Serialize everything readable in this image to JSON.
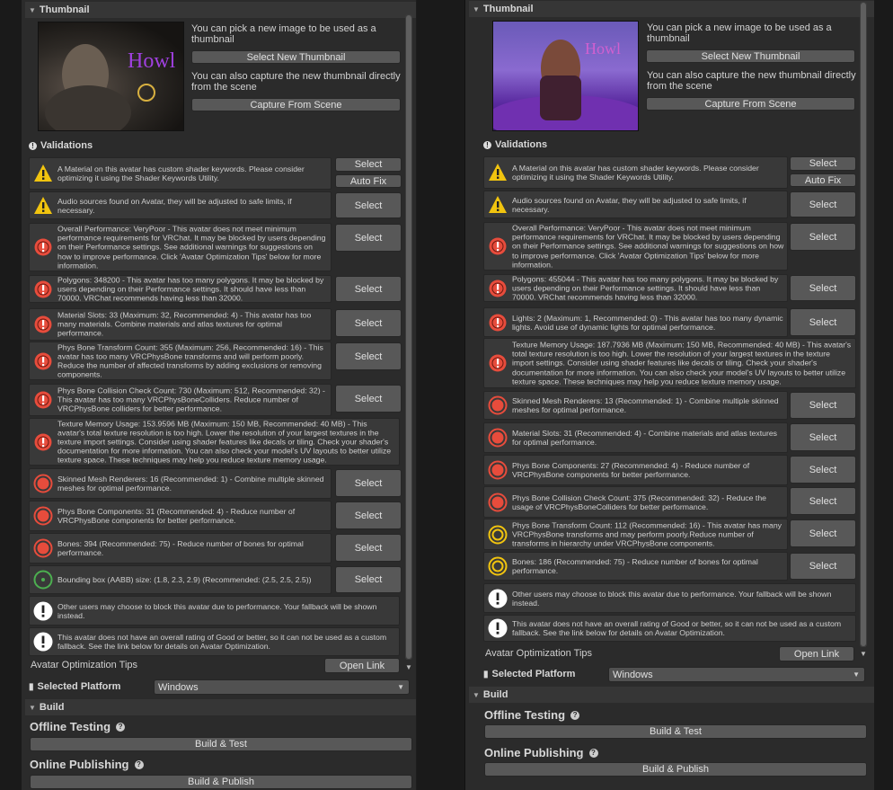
{
  "colors": {
    "panel": "#2b2b2b",
    "row": "#393939",
    "button": "#585858",
    "warn": "#f1c40f",
    "error": "#e74c3c",
    "info": "#ffffff",
    "good": "#4caf50"
  },
  "icons": {
    "warning": "warning-triangle-icon",
    "error": "error-circle-icon",
    "perf_bad": "performance-bad-icon",
    "perf_med": "performance-medium-icon",
    "perf_good": "performance-good-icon",
    "info": "info-circle-icon",
    "help": "help-icon"
  },
  "left": {
    "thumbnail": {
      "header": "Thumbnail",
      "pick_text": "You can pick a new image to be used as a thumbnail",
      "select_button": "Select New Thumbnail",
      "capture_text": "You can also capture the new thumbnail directly from the scene",
      "capture_button": "Capture From Scene",
      "image_text": "Howl"
    },
    "validations": {
      "header": "Validations",
      "items": [
        {
          "icon": "warning",
          "text": "A Material on this avatar has custom shader keywords. Please consider optimizing it using the Shader Keywords Utility.",
          "select": "Select",
          "fix": "Auto Fix"
        },
        {
          "icon": "warning",
          "text": "Audio sources found on Avatar, they will be adjusted to safe limits, if necessary.",
          "select": "Select"
        },
        {
          "icon": "error",
          "text": "Overall Performance: VeryPoor - This avatar does not meet minimum performance requirements for VRChat. It may be blocked by users depending on their Performance settings. See additional warnings for suggestions on how to improve performance. Click 'Avatar Optimization Tips' below for more information.",
          "select": "Select"
        },
        {
          "icon": "error",
          "text": "Polygons: 348200 - This avatar has too many polygons. It may be blocked by users depending on their Performance settings. It should have less than 70000. VRChat recommends having less than 32000.",
          "select": "Select"
        },
        {
          "icon": "error",
          "text": "Material Slots: 33 (Maximum: 32, Recommended: 4) - This avatar has too many materials. Combine materials and atlas textures for optimal performance.",
          "select": "Select"
        },
        {
          "icon": "error",
          "text": "Phys Bone Transform Count: 355 (Maximum: 256, Recommended: 16) - This avatar has too many VRCPhysBone transforms and will perform poorly. Reduce the number of affected transforms by adding exclusions or removing components.",
          "select": "Select"
        },
        {
          "icon": "error",
          "text": "Phys Bone Collision Check Count: 730 (Maximum: 512, Recommended: 32) - This avatar has too many VRCPhysBoneColliders. Reduce number of VRCPhysBone colliders for better performance.",
          "select": "Select"
        },
        {
          "icon": "error",
          "text": "Texture Memory Usage: 153.9596 MB (Maximum: 150 MB, Recommended: 40 MB) - This avatar's total texture resolution is too high. Lower the resolution of your largest textures in the texture import settings. Consider using shader features like decals or tiling. Check your shader's documentation for more information. You can also check your model's UV layouts to better utilize texture space. These techniques may help you reduce texture memory usage."
        },
        {
          "icon": "perf_bad",
          "text": "Skinned Mesh Renderers: 16 (Recommended: 1) - Combine multiple skinned meshes for optimal performance.",
          "select": "Select"
        },
        {
          "icon": "perf_bad",
          "text": "Phys Bone Components: 31 (Recommended: 4) - Reduce number of VRCPhysBone components for better performance.",
          "select": "Select"
        },
        {
          "icon": "perf_bad",
          "text": "Bones: 394 (Recommended: 75) - Reduce number of bones for optimal performance.",
          "select": "Select"
        },
        {
          "icon": "perf_good",
          "text": "Bounding box (AABB) size: (1.8, 2.3, 2.9) (Recommended: (2.5, 2.5, 2.5))",
          "select": "Select"
        },
        {
          "icon": "info",
          "text": "Other users may choose to block this avatar due to performance. Your fallback will be shown instead."
        },
        {
          "icon": "info",
          "text": "This avatar does not have an overall rating of Good or better, so it can not be used as a custom fallback. See the link below for details on Avatar Optimization."
        }
      ]
    },
    "tips_label": "Avatar Optimization Tips",
    "open_link": "Open Link",
    "platform_label": "Selected Platform",
    "platform_value": "Windows",
    "build_header": "Build",
    "offline_label": "Offline Testing",
    "build_test": "Build & Test",
    "online_label": "Online Publishing",
    "build_publish": "Build & Publish"
  },
  "right": {
    "thumbnail": {
      "header": "Thumbnail",
      "pick_text": "You can pick a new image to be used as a thumbnail",
      "select_button": "Select New Thumbnail",
      "capture_text": "You can also capture the new thumbnail directly from the scene",
      "capture_button": "Capture From Scene",
      "image_text": "Howl"
    },
    "validations": {
      "header": "Validations",
      "items": [
        {
          "icon": "warning",
          "text": "A Material on this avatar has custom shader keywords. Please consider optimizing it using the Shader Keywords Utility.",
          "select": "Select",
          "fix": "Auto Fix"
        },
        {
          "icon": "warning",
          "text": "Audio sources found on Avatar, they will be adjusted to safe limits, if necessary.",
          "select": "Select"
        },
        {
          "icon": "error",
          "text": "Overall Performance: VeryPoor - This avatar does not meet minimum performance requirements for VRChat. It may be blocked by users depending on their Performance settings. See additional warnings for suggestions on how to improve performance. Click 'Avatar Optimization Tips' below for more information.",
          "select": "Select"
        },
        {
          "icon": "error",
          "text": "Polygons: 455044 - This avatar has too many polygons. It may be blocked by users depending on their Performance settings. It should have less than 70000. VRChat recommends having less than 32000.",
          "select": "Select"
        },
        {
          "icon": "error",
          "text": "Lights: 2 (Maximum: 1, Recommended: 0) - This avatar has too many dynamic lights. Avoid use of dynamic lights for optimal performance.",
          "select": "Select"
        },
        {
          "icon": "error",
          "text": "Texture Memory Usage: 187.7936 MB (Maximum: 150 MB, Recommended: 40 MB) - This avatar's total texture resolution is too high. Lower the resolution of your largest textures in the texture import settings. Consider using shader features like decals or tiling. Check your shader's documentation for more information. You can also check your model's UV layouts to better utilize texture space. These techniques may help you reduce texture memory usage."
        },
        {
          "icon": "perf_bad",
          "text": "Skinned Mesh Renderers: 13 (Recommended: 1) - Combine multiple skinned meshes for optimal performance.",
          "select": "Select"
        },
        {
          "icon": "perf_bad",
          "text": "Material Slots: 31 (Recommended: 4) - Combine materials and atlas textures for optimal performance.",
          "select": "Select"
        },
        {
          "icon": "perf_bad",
          "text": "Phys Bone Components: 27 (Recommended: 4) - Reduce number of VRCPhysBone components for better performance.",
          "select": "Select"
        },
        {
          "icon": "perf_bad",
          "text": "Phys Bone Collision Check Count: 375 (Recommended: 32) - Reduce the usage of VRCPhysBoneColliders for better performance.",
          "select": "Select"
        },
        {
          "icon": "perf_med",
          "text": "Phys Bone Transform Count: 112 (Recommended: 16) - This avatar has many VRCPhysBone transforms and may perform poorly.Reduce number of transforms in hierarchy under VRCPhysBone components.",
          "select": "Select"
        },
        {
          "icon": "perf_med",
          "text": "Bones: 186 (Recommended: 75) - Reduce number of bones for optimal performance.",
          "select": "Select"
        },
        {
          "icon": "info",
          "text": "Other users may choose to block this avatar due to performance. Your fallback will be shown instead."
        },
        {
          "icon": "info",
          "text": "This avatar does not have an overall rating of Good or better, so it can not be used as a custom fallback. See the link below for details on Avatar Optimization."
        }
      ]
    },
    "tips_label": "Avatar Optimization Tips",
    "open_link": "Open Link",
    "platform_label": "Selected Platform",
    "platform_value": "Windows",
    "build_header": "Build",
    "offline_label": "Offline Testing",
    "build_test": "Build & Test",
    "online_label": "Online Publishing",
    "build_publish": "Build & Publish"
  }
}
